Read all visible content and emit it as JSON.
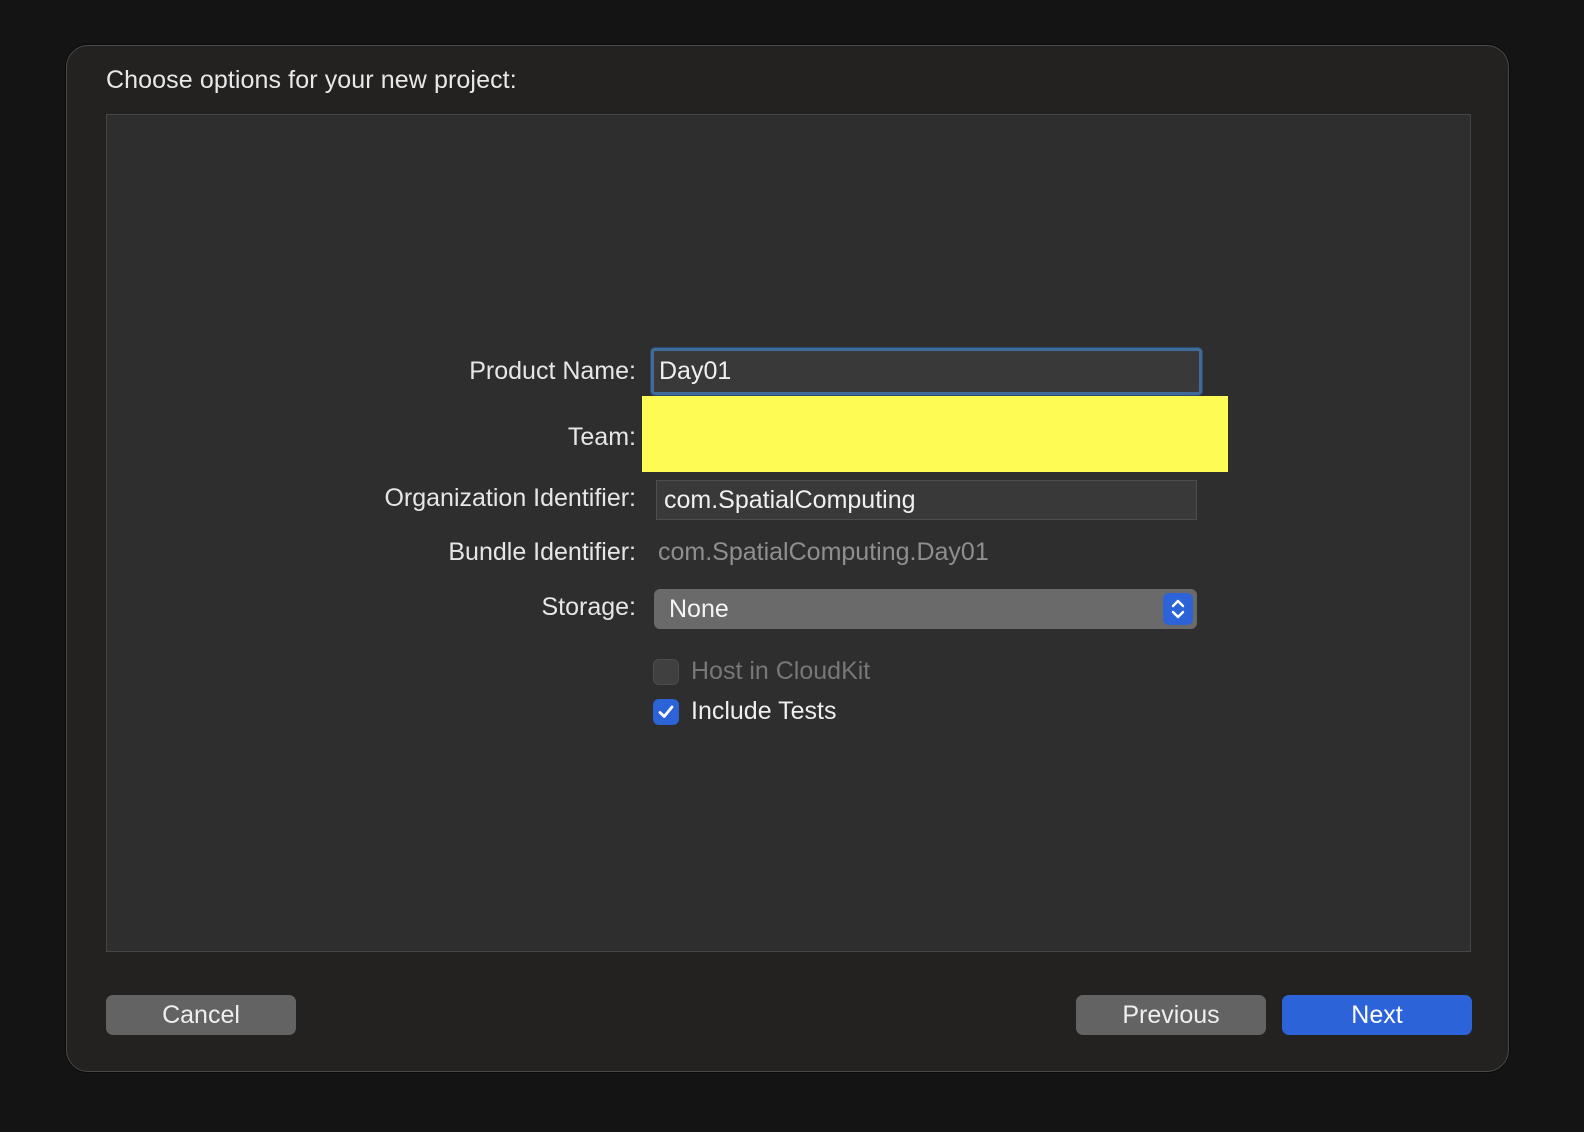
{
  "dialog": {
    "title": "Choose options for your new project:"
  },
  "form": {
    "product_name": {
      "label": "Product Name:",
      "value": "Day01"
    },
    "team": {
      "label": "Team:"
    },
    "organization_identifier": {
      "label": "Organization Identifier:",
      "value": "com.SpatialComputing"
    },
    "bundle_identifier": {
      "label": "Bundle Identifier:",
      "value": "com.SpatialComputing.Day01"
    },
    "storage": {
      "label": "Storage:",
      "selected": "None"
    },
    "host_in_cloudkit": {
      "label": "Host in CloudKit",
      "checked": false,
      "enabled": false
    },
    "include_tests": {
      "label": "Include Tests",
      "checked": true,
      "enabled": true
    }
  },
  "buttons": {
    "cancel": "Cancel",
    "previous": "Previous",
    "next": "Next"
  },
  "colors": {
    "accent": "#2c63d8",
    "redaction": "#fefc54"
  }
}
